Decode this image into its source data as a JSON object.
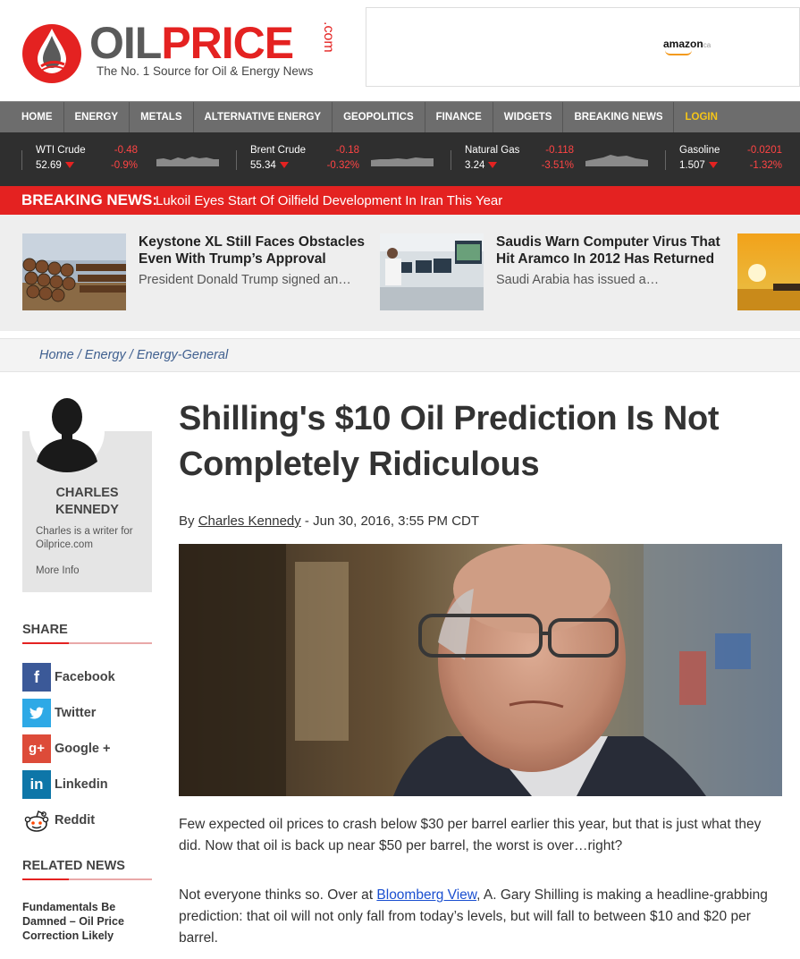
{
  "header": {
    "logo_oil": "OIL",
    "logo_price": "PRICE",
    "logo_com": ".com",
    "tagline": "The No. 1 Source for Oil & Energy News",
    "ad_brand": "amazon",
    "ad_brand_suffix": "ca"
  },
  "nav": {
    "items": [
      "HOME",
      "ENERGY",
      "METALS",
      "ALTERNATIVE ENERGY",
      "GEOPOLITICS",
      "FINANCE",
      "WIDGETS",
      "BREAKING NEWS"
    ],
    "login": "LOGIN"
  },
  "ticker": [
    {
      "name": "WTI Crude",
      "price": "52.69",
      "change": "-0.48",
      "percent": "-0.9%"
    },
    {
      "name": "Brent Crude",
      "price": "55.34",
      "change": "-0.18",
      "percent": "-0.32%"
    },
    {
      "name": "Natural Gas",
      "price": "3.24",
      "change": "-0.118",
      "percent": "-3.51%"
    },
    {
      "name": "Gasoline",
      "price": "1.507",
      "change": "-0.0201",
      "percent": "-1.32%"
    }
  ],
  "breaking": {
    "label": "BREAKING NEWS:",
    "text": "Lukoil Eyes Start Of Oilfield Development In Iran This Year"
  },
  "featured": [
    {
      "title": "Keystone XL Still Faces Obstacles Even With Trump’s Approval",
      "excerpt": "President Donald Trump signed an…"
    },
    {
      "title": "Saudis Warn Computer Virus That Hit Aramco In 2012 Has Returned",
      "excerpt": "Saudi Arabia has issued a…"
    }
  ],
  "breadcrumb": {
    "home": "Home",
    "sep": " / ",
    "energy": "Energy",
    "general": "Energy-General"
  },
  "author": {
    "name_line1": "CHARLES",
    "name_line2": "KENNEDY",
    "bio": "Charles is a writer for Oilprice.com",
    "more": "More Info"
  },
  "share": {
    "heading": "SHARE",
    "items": [
      "Facebook",
      "Twitter",
      "Google +",
      "Linkedin",
      "Reddit"
    ]
  },
  "related": {
    "heading": "RELATED NEWS",
    "first": "Fundamentals Be Damned – Oil Price Correction Likely"
  },
  "article": {
    "title": "Shilling's $10 Oil Prediction Is Not Completely Ridiculous",
    "by": "By ",
    "author": "Charles Kennedy",
    "date": " - Jun 30, 2016, 3:55 PM CDT",
    "p1": "Few expected oil prices to crash below $30 per barrel earlier this year, but that is just what they did. Now that oil is back up near $50 per barrel, the worst is over…right?",
    "p2_a": "Not everyone thinks so. Over at ",
    "p2_link": "Bloomberg View",
    "p2_b": ", A. Gary Shilling is making a headline-grabbing prediction: that oil will not only fall from today’s levels, but will fall to between $10 and $20 per barrel."
  },
  "colors": {
    "brand_red": "#e42221",
    "nav_gray": "#6d6d6d",
    "ticker_bg": "#2f2f2f",
    "login_yellow": "#f5c518"
  }
}
